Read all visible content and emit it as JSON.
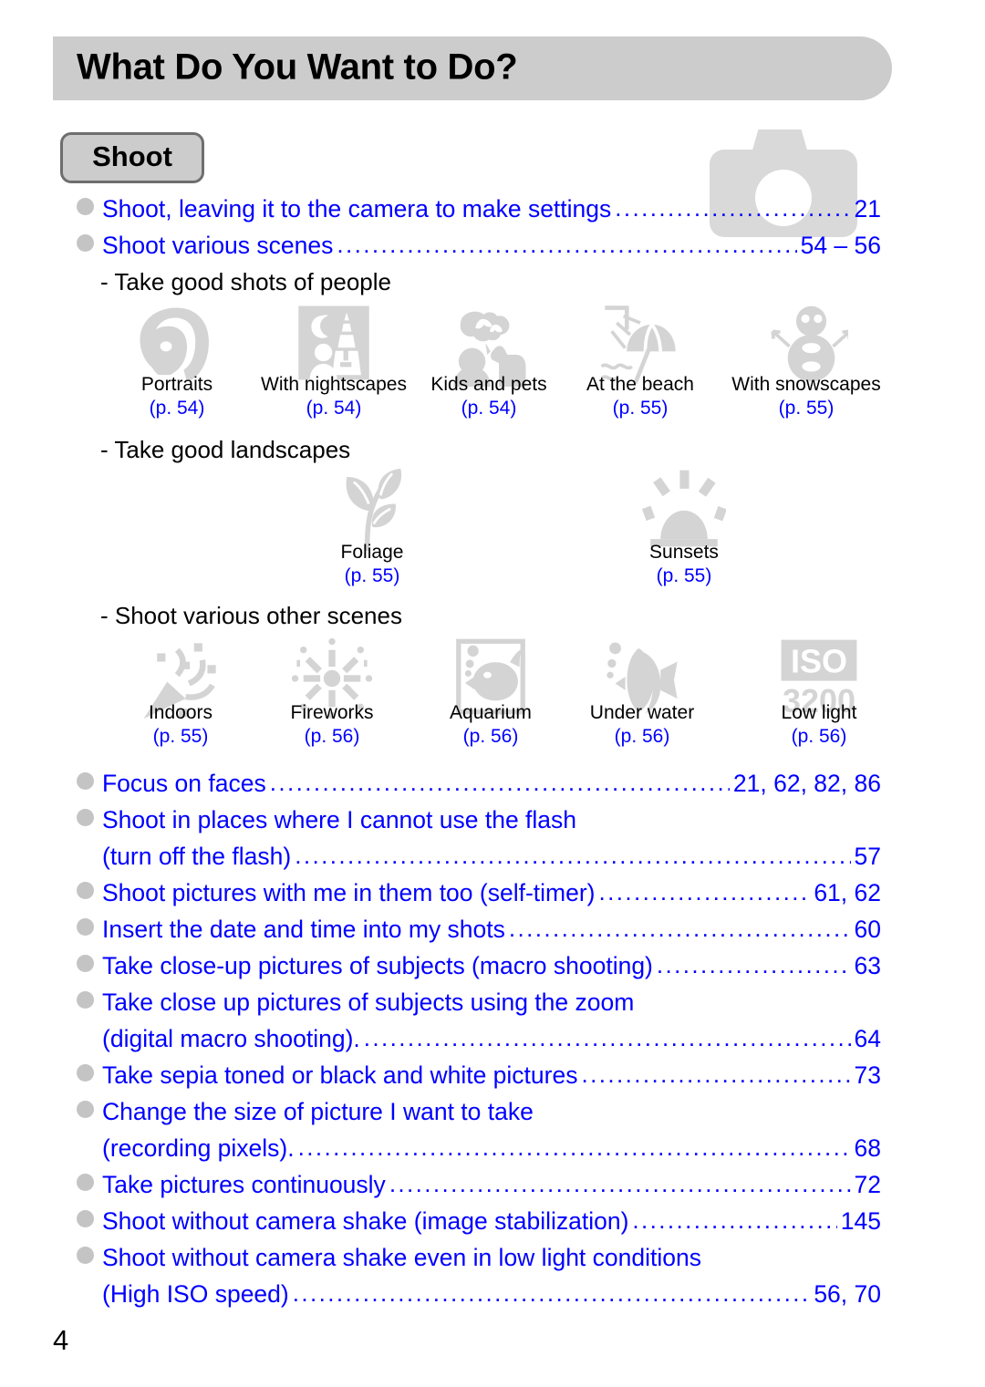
{
  "header": {
    "title": "What Do You Want to Do?"
  },
  "section": {
    "tab_label": "Shoot",
    "watermark_icon": "camera-icon"
  },
  "colors": {
    "link_blue": "#0000ff",
    "bullet_gray": "#c4c4c4",
    "bar_gray": "#cccccc",
    "icon_gray": "#d4d4d4",
    "tab_border": "#6e6e6e"
  },
  "top_links": [
    {
      "text": "Shoot, leaving it to the camera to make settings",
      "page": "21"
    },
    {
      "text": "Shoot various scenes",
      "page": "54 – 56"
    }
  ],
  "subsections": [
    {
      "heading": "- Take good shots of people",
      "icons": [
        {
          "label": "Portraits",
          "page": "(p. 54)",
          "icon": "portrait-face-icon"
        },
        {
          "label": "With nightscapes",
          "page": "(p. 54)",
          "icon": "nightscape-icon"
        },
        {
          "label": "Kids and pets",
          "page": "(p. 54)",
          "icon": "kids-and-pets-icon"
        },
        {
          "label": "At the beach",
          "page": "(p. 55)",
          "icon": "beach-umbrella-icon"
        },
        {
          "label": "With snowscapes",
          "page": "(p. 55)",
          "icon": "snowman-icon"
        }
      ]
    },
    {
      "heading": "- Take good landscapes",
      "icons": [
        {
          "label": "Foliage",
          "page": "(p. 55)",
          "icon": "leaf-foliage-icon"
        },
        {
          "label": "Sunsets",
          "page": "(p. 55)",
          "icon": "sunset-icon"
        }
      ]
    },
    {
      "heading": "- Shoot various other scenes",
      "icons": [
        {
          "label": "Indoors",
          "page": "(p. 55)",
          "icon": "indoors-party-icon"
        },
        {
          "label": "Fireworks",
          "page": "(p. 56)",
          "icon": "fireworks-icon"
        },
        {
          "label": "Aquarium",
          "page": "(p. 56)",
          "icon": "aquarium-fish-icon"
        },
        {
          "label": "Under water",
          "page": "(p. 56)",
          "icon": "underwater-fish-icon"
        },
        {
          "label": "Low light",
          "page": "(p. 56)",
          "icon": "iso-3200-icon"
        }
      ]
    }
  ],
  "bottom_links": [
    {
      "lines": [
        "Focus on faces"
      ],
      "page": "21, 62, 82, 86"
    },
    {
      "lines": [
        "Shoot in places where I cannot use the flash",
        "(turn off the flash)"
      ],
      "page": "57"
    },
    {
      "lines": [
        "Shoot pictures with me in them too (self-timer)"
      ],
      "page": "61, 62"
    },
    {
      "lines": [
        "Insert the date and time into my shots"
      ],
      "page": "60"
    },
    {
      "lines": [
        "Take close-up pictures of subjects (macro shooting)"
      ],
      "page": "63"
    },
    {
      "lines": [
        "Take close up pictures of subjects using the zoom",
        "(digital macro shooting)."
      ],
      "page": "64"
    },
    {
      "lines": [
        "Take sepia toned or black and white pictures"
      ],
      "page": "73"
    },
    {
      "lines": [
        "Change the size of picture I want to take",
        "(recording pixels)."
      ],
      "page": "68"
    },
    {
      "lines": [
        "Take pictures continuously"
      ],
      "page": "72"
    },
    {
      "lines": [
        "Shoot without camera shake (image stabilization)"
      ],
      "page": "145"
    },
    {
      "lines": [
        "Shoot without camera shake even in low light conditions",
        "(High ISO speed)"
      ],
      "page": "56, 70"
    }
  ],
  "footer": {
    "page_number": "4"
  }
}
